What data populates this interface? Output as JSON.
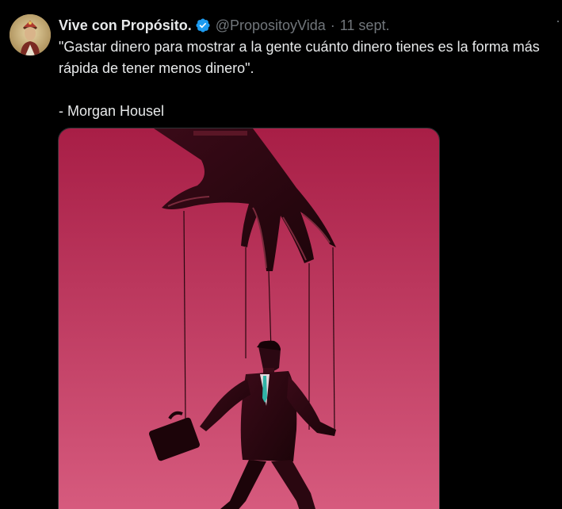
{
  "tweet": {
    "display_name": "Vive con Propósito.",
    "handle": "@PropositoyVida",
    "separator": "·",
    "date": "11 sept.",
    "more": "··",
    "text_line1": "\"Gastar dinero para mostrar a la gente cuánto dinero tienes es la forma más",
    "text_line2": "rápida de tener menos dinero\".",
    "text_line3": "- Morgan Housel"
  },
  "icons": {
    "verified": "verified-badge-icon",
    "more": "more-options-icon"
  },
  "colors": {
    "background": "#000000",
    "text_primary": "#e7e9ea",
    "text_secondary": "#71767b",
    "verified_blue": "#1d9bf0",
    "image_background_top": "#a81e46",
    "image_background_bottom": "#d65a7e"
  }
}
